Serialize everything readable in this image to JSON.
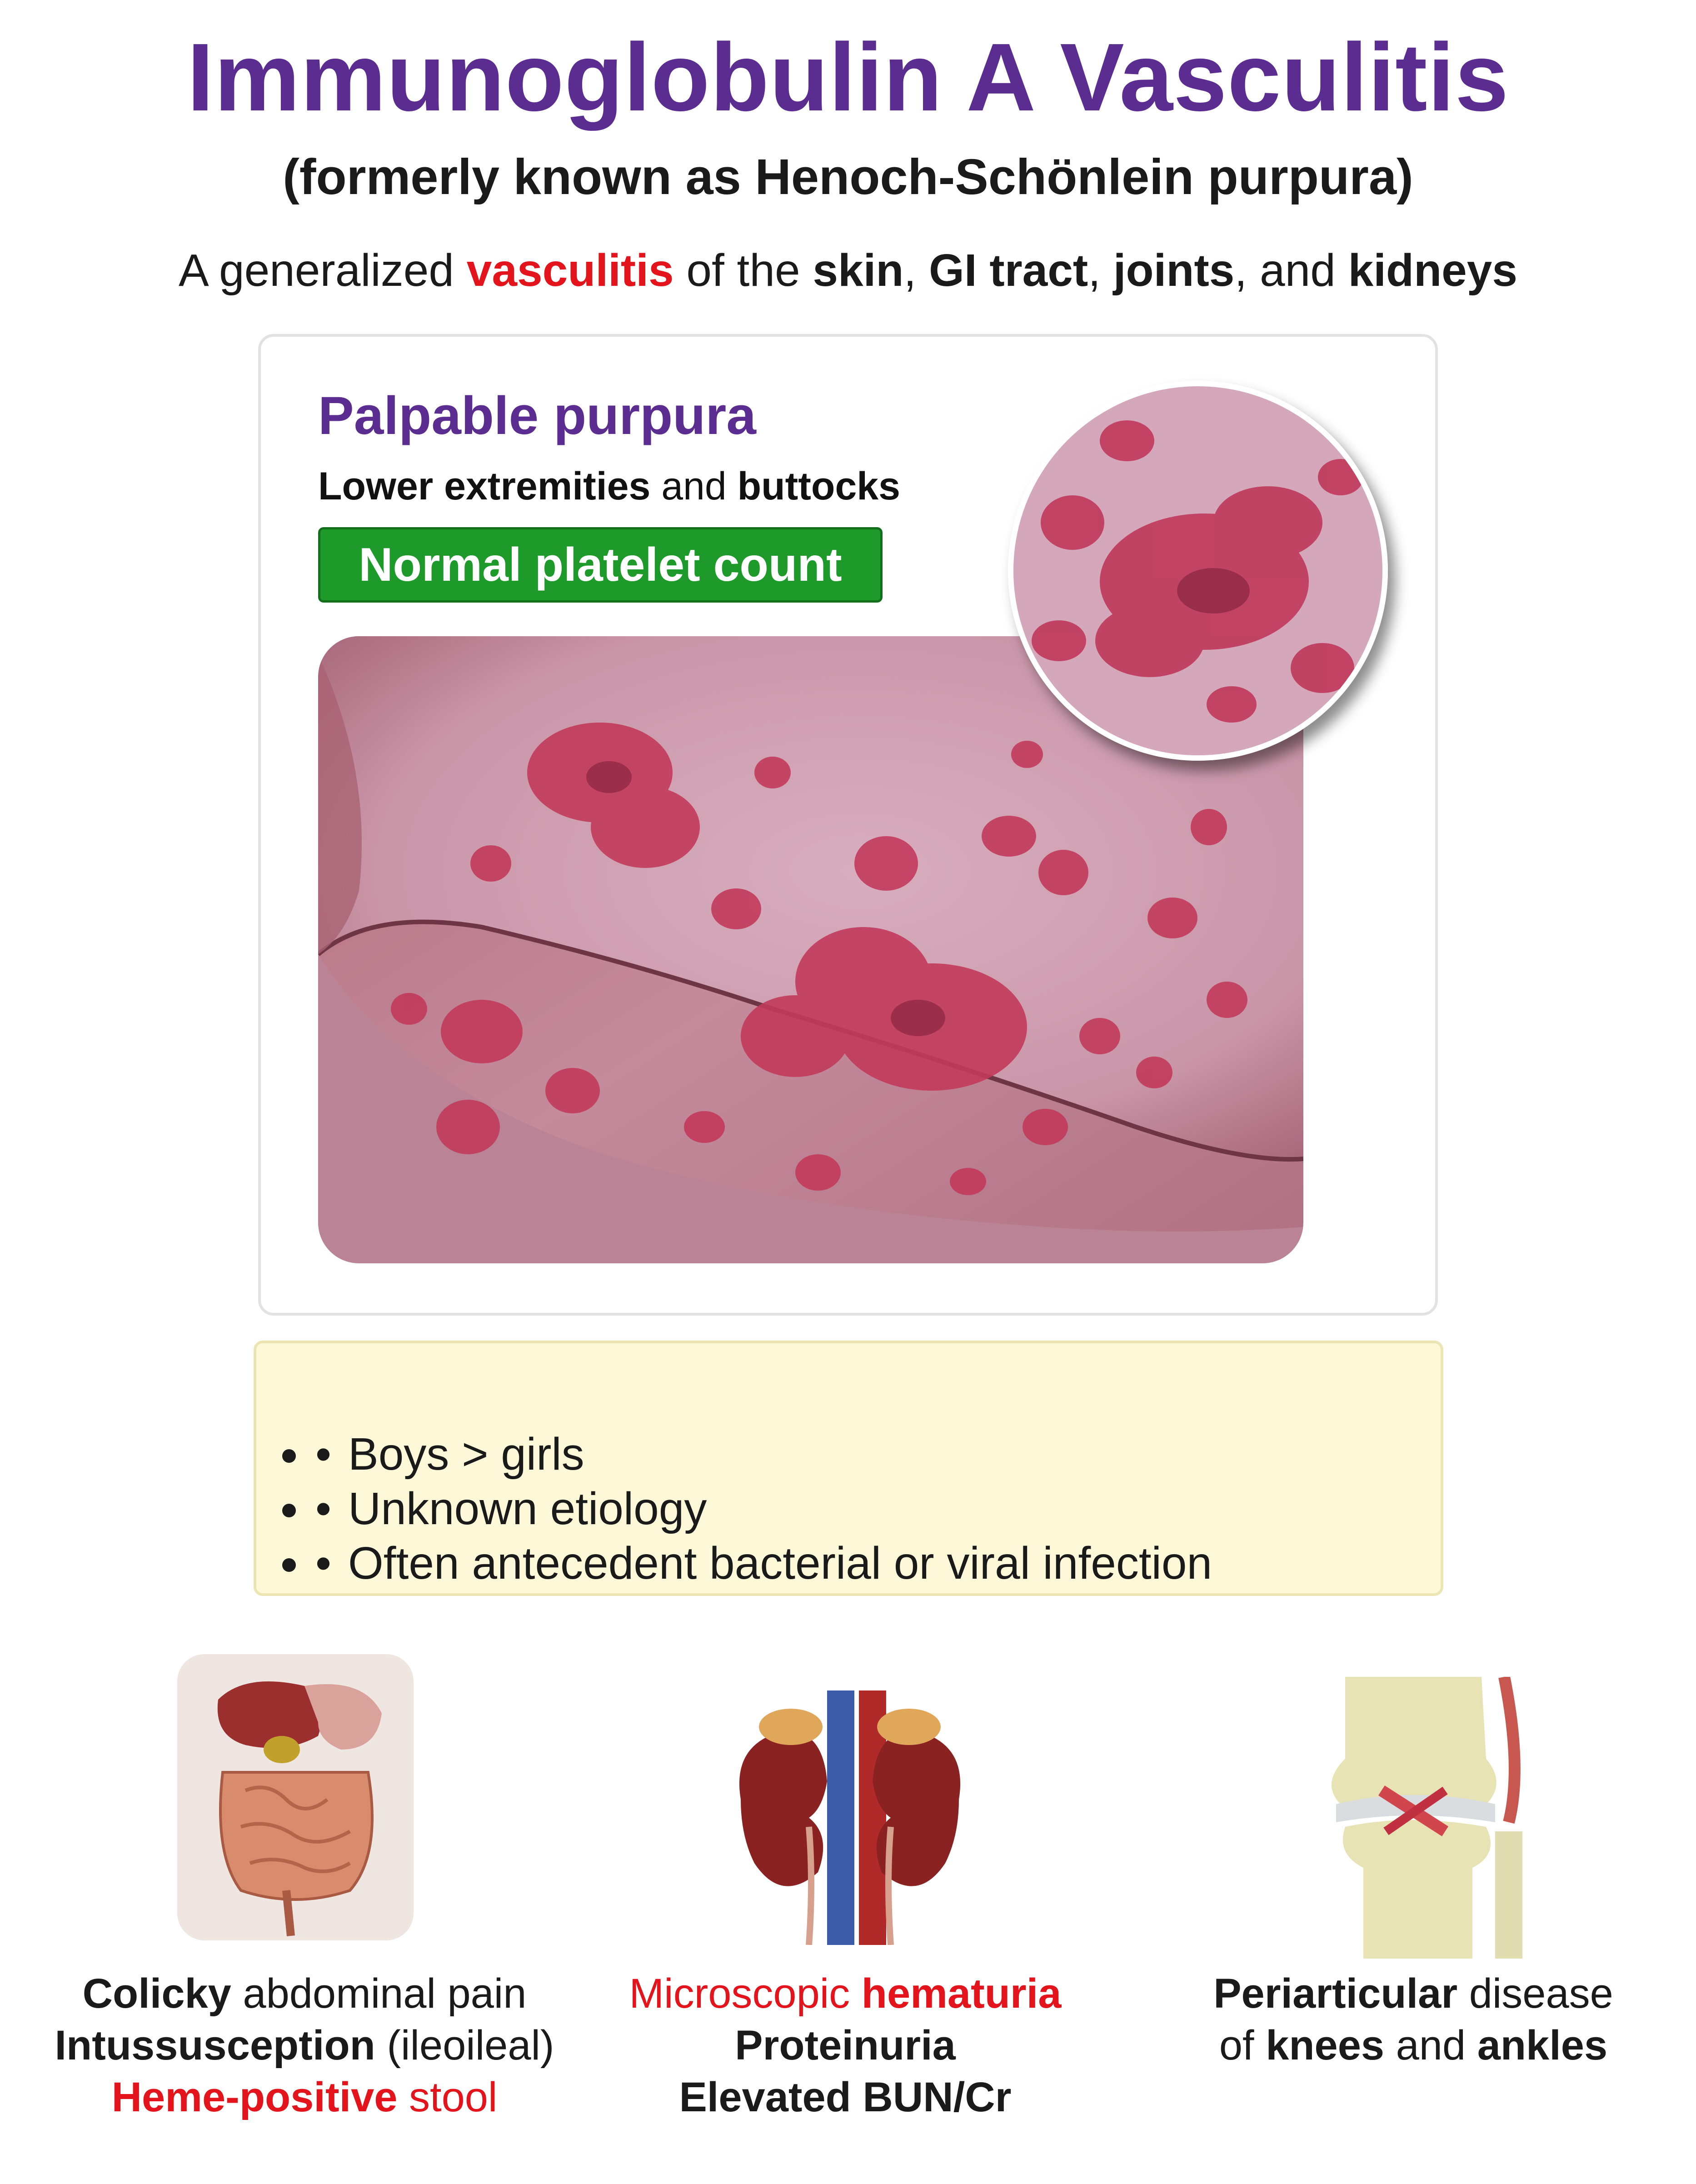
{
  "header": {
    "title": "Immunoglobulin A Vasculitis",
    "subtitle": "(formerly known as Henoch-Schönlein purpura)",
    "tagline": {
      "prefix": "A generalized ",
      "highlight": "vasculitis",
      "of_the": " of the ",
      "skin": "skin",
      "sep1": ", ",
      "gi": "GI tract",
      "sep2": ", ",
      "joints": "joints",
      "and": ", and ",
      "kidneys": "kidneys"
    }
  },
  "card": {
    "title": "Palpable purpura",
    "location_a": "Lower extremities",
    "location_and": " and ",
    "location_b": "buttocks",
    "badge": "Normal platelet count",
    "photo": "palpable-purpura-skin-photo",
    "zoom": "purpura-closeup-magnified"
  },
  "notes": [
    "Boys > girls",
    "Unknown etiology",
    "Often antecedent bacterial or viral infection"
  ],
  "organs": {
    "gi": {
      "icon": "gastrointestinal-tract-icon",
      "line1_bold": "Colicky",
      "line1_rest": " abdominal pain",
      "line2_bold": "Intussusception",
      "line2_rest": " (ileoileal)",
      "line3_bold": "Heme-positive",
      "line3_rest": " stool"
    },
    "kidney": {
      "icon": "kidneys-icon",
      "line1_rest": "Microscopic ",
      "line1_bold": "hematuria",
      "line2": "Proteinuria",
      "line3": "Elevated BUN/Cr"
    },
    "knee": {
      "icon": "knee-joint-icon",
      "line1_bold": "Periarticular",
      "line1_rest": " disease",
      "line2_pre": "of ",
      "line2_bold_a": "knees",
      "line2_mid": " and ",
      "line2_bold_b": "ankles"
    }
  },
  "colors": {
    "title": "#5b2d91",
    "highlight": "#e3141b",
    "badge": "#1e9a2a",
    "note_bg": "#fdf8d8"
  }
}
